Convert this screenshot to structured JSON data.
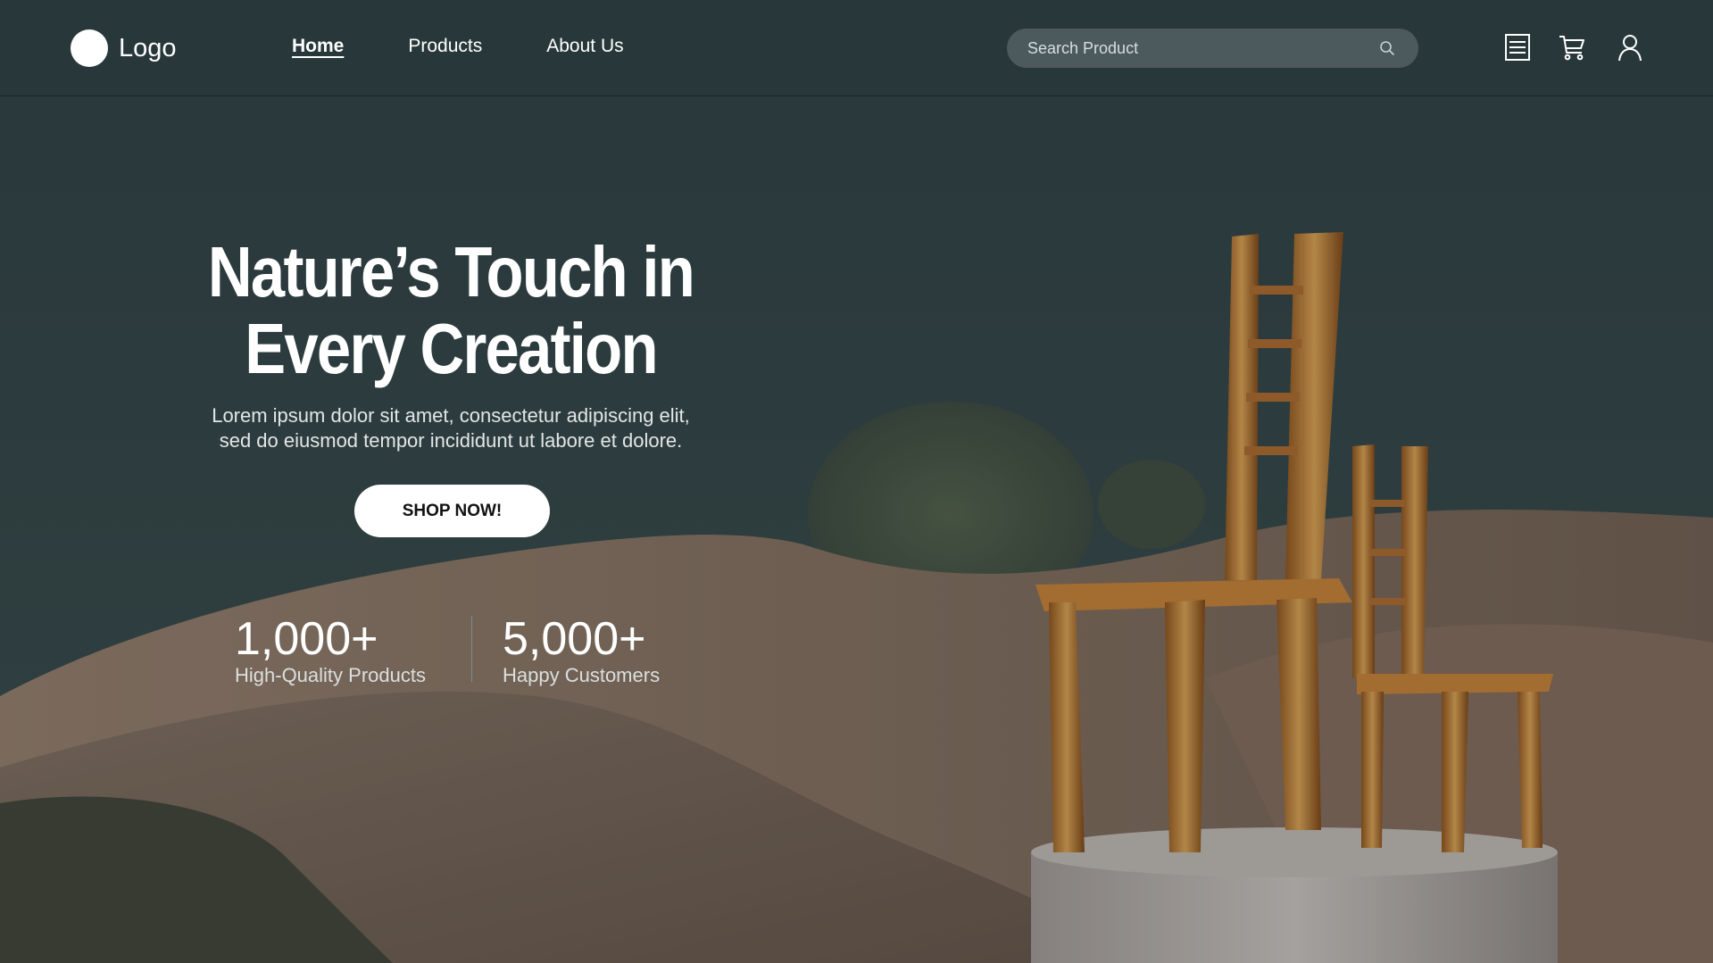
{
  "brand": {
    "logo_text": "Logo"
  },
  "nav": {
    "items": [
      {
        "label": "Home",
        "active": true
      },
      {
        "label": "Products",
        "active": false
      },
      {
        "label": "About Us",
        "active": false
      }
    ]
  },
  "search": {
    "placeholder": "Search Product",
    "value": ""
  },
  "header_icons": [
    "menu-list-icon",
    "cart-icon",
    "user-icon"
  ],
  "hero": {
    "title_line1": "Nature’s Touch in",
    "title_line2": "Every Creation",
    "subtitle_line1": "Lorem ipsum dolor sit amet, consectetur adipiscing elit,",
    "subtitle_line2": "sed do eiusmod tempor incididunt ut labore et dolore.",
    "cta_label": "SHOP NOW!"
  },
  "stats": [
    {
      "value": "1,000+",
      "label": "High-Quality Products"
    },
    {
      "value": "5,000+",
      "label": "Happy Customers"
    }
  ],
  "colors": {
    "background_sky": "#2e3e41",
    "sand": "#8a7463",
    "wood": "#b5712a",
    "search_bg": "#4c5a5d",
    "text": "#ffffff"
  }
}
